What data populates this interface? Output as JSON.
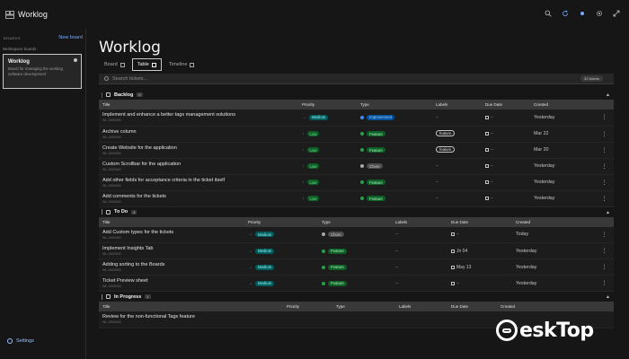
{
  "app": {
    "title": "Worklog"
  },
  "topbar": {
    "icons": [
      "search-icon",
      "refresh-icon",
      "theme-icon",
      "settings-gear-icon",
      "expand-icon"
    ]
  },
  "sidebar": {
    "section_label": "BOARDS",
    "new_board": "New board",
    "sub_label": "Workspace boards",
    "board": {
      "name": "Worklog",
      "description": "Board for managing the worklog software development"
    },
    "settings_label": "Settings"
  },
  "main": {
    "title": "Worklog",
    "tabs": [
      {
        "label": "Board"
      },
      {
        "label": "Table"
      },
      {
        "label": "Timeline"
      }
    ],
    "search": {
      "placeholder": "Search tickets...",
      "count": "32 tickets"
    }
  },
  "columns": {
    "title": "Title",
    "priority": "Priority",
    "type": "Type",
    "labels": "Labels",
    "due": "Due Date",
    "created": "Created"
  },
  "groups": [
    {
      "name": "Backlog",
      "count": "6",
      "color": "#da1e28",
      "rows": [
        {
          "title": "Implement and enhance a better tags management solutions",
          "id": "WL-0000000",
          "priority": "Medium",
          "type": "Improvement",
          "label": "",
          "due": "",
          "created": "Yesterday"
        },
        {
          "title": "Archive column",
          "id": "WL-0000000",
          "priority": "Low",
          "type": "Feature",
          "label": "feature",
          "due": "",
          "created": "Mar 22"
        },
        {
          "title": "Create Website for the application",
          "id": "WL-0000000",
          "priority": "Low",
          "type": "Feature",
          "label": "feature",
          "due": "",
          "created": "Mar 20"
        },
        {
          "title": "Custom Scrollbar for the application",
          "id": "WL-0000000",
          "priority": "Low",
          "type": "Chore",
          "label": "",
          "due": "",
          "created": "Yesterday"
        },
        {
          "title": "Add other fields for acceptance criteria in the ticket itself",
          "id": "WL-0000000",
          "priority": "Low",
          "type": "Feature",
          "label": "",
          "due": "",
          "created": "Yesterday"
        },
        {
          "title": "Add comments for the tickets",
          "id": "WL-0000000",
          "priority": "Low",
          "type": "Feature",
          "label": "",
          "due": "",
          "created": "Yesterday"
        }
      ]
    },
    {
      "name": "To Do",
      "count": "4",
      "color": "#4589ff",
      "rows": [
        {
          "title": "Add Custom types for the tickets",
          "id": "WL-0000000",
          "priority": "Medium",
          "type": "Chore",
          "label": "",
          "due": "",
          "created": "Today"
        },
        {
          "title": "Implement Insights Tab",
          "id": "WL-0000000",
          "priority": "Medium",
          "type": "Feature",
          "label": "",
          "due": "Jn 04",
          "created": "Yesterday"
        },
        {
          "title": "Adding sorting to the Boards",
          "id": "WL-0000000",
          "priority": "Medium",
          "type": "Feature",
          "label": "",
          "due": "May 13",
          "created": "Yesterday"
        },
        {
          "title": "Ticket Preview sheet",
          "id": "WL-0000000",
          "priority": "Medium",
          "type": "Feature",
          "label": "",
          "due": "",
          "created": "Yesterday"
        }
      ]
    },
    {
      "name": "In Progress",
      "count": "1",
      "color": "#4589ff",
      "rows": [
        {
          "title": "Review for the non-functional Tags feature",
          "id": "WL-0000000",
          "priority": "",
          "type": "",
          "label": "",
          "due": "",
          "created": ""
        }
      ]
    }
  ],
  "watermark": {
    "text": "eskTop"
  },
  "colors": {
    "bg": "#161616",
    "accent": "#78a9ff",
    "medium": "#33b1ff",
    "low": "#24a148"
  }
}
